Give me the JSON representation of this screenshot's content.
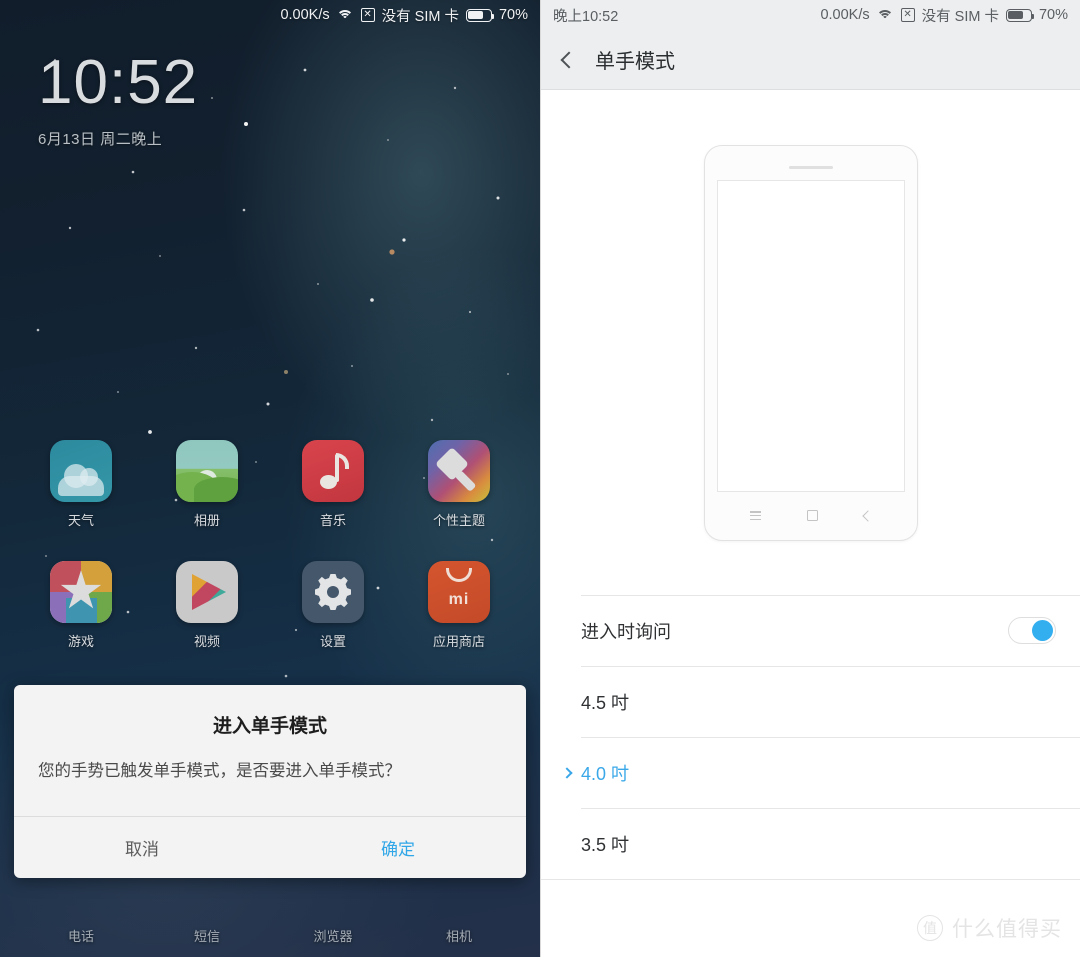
{
  "home": {
    "statusbar": {
      "netspeed": "0.00K/s",
      "wifi_icon": "wifi-icon",
      "sim_icon": "sim-error-icon",
      "sim_text": "没有 SIM 卡",
      "battery_icon": "battery-icon",
      "battery_text": "70%",
      "battery_level": 70
    },
    "clock": {
      "time": "10:52",
      "date": "6月13日 周二晚上"
    },
    "apps": [
      {
        "label": "天气",
        "icon": "weather-icon"
      },
      {
        "label": "相册",
        "icon": "gallery-icon"
      },
      {
        "label": "音乐",
        "icon": "music-icon"
      },
      {
        "label": "个性主题",
        "icon": "theme-icon"
      },
      {
        "label": "游戏",
        "icon": "games-icon"
      },
      {
        "label": "视频",
        "icon": "video-icon"
      },
      {
        "label": "设置",
        "icon": "settings-icon"
      },
      {
        "label": "应用商店",
        "icon": "app-store-icon"
      }
    ],
    "dock": [
      {
        "label": "电话"
      },
      {
        "label": "短信"
      },
      {
        "label": "浏览器"
      },
      {
        "label": "相机"
      }
    ],
    "dialog": {
      "title": "进入单手模式",
      "message": "您的手势已触发单手模式，是否要进入单手模式？",
      "cancel_label": "取消",
      "confirm_label": "确定",
      "confirm_color": "#2fa6e8"
    }
  },
  "settings": {
    "statusbar": {
      "clock": "晚上10:52",
      "netspeed": "0.00K/s",
      "wifi_icon": "wifi-icon",
      "sim_icon": "sim-error-icon",
      "sim_text": "没有 SIM 卡",
      "battery_icon": "battery-icon",
      "battery_text": "70%",
      "battery_level": 70
    },
    "appbar": {
      "back_icon": "back-chevron-icon",
      "title": "单手模式"
    },
    "preview": {
      "name": "phone-illustration",
      "nav_menu_icon": "menu-icon",
      "nav_home_icon": "home-icon",
      "nav_back_icon": "back-icon"
    },
    "rows": [
      {
        "label": "进入时询问",
        "type": "toggle",
        "value": true,
        "selected": false
      },
      {
        "label": "4.5 吋",
        "type": "option",
        "selected": false
      },
      {
        "label": "4.0 吋",
        "type": "option",
        "selected": true
      },
      {
        "label": "3.5 吋",
        "type": "option",
        "selected": false
      }
    ],
    "accent_color": "#33aeef",
    "watermark": {
      "logo": "值",
      "text": "什么值得买"
    }
  }
}
